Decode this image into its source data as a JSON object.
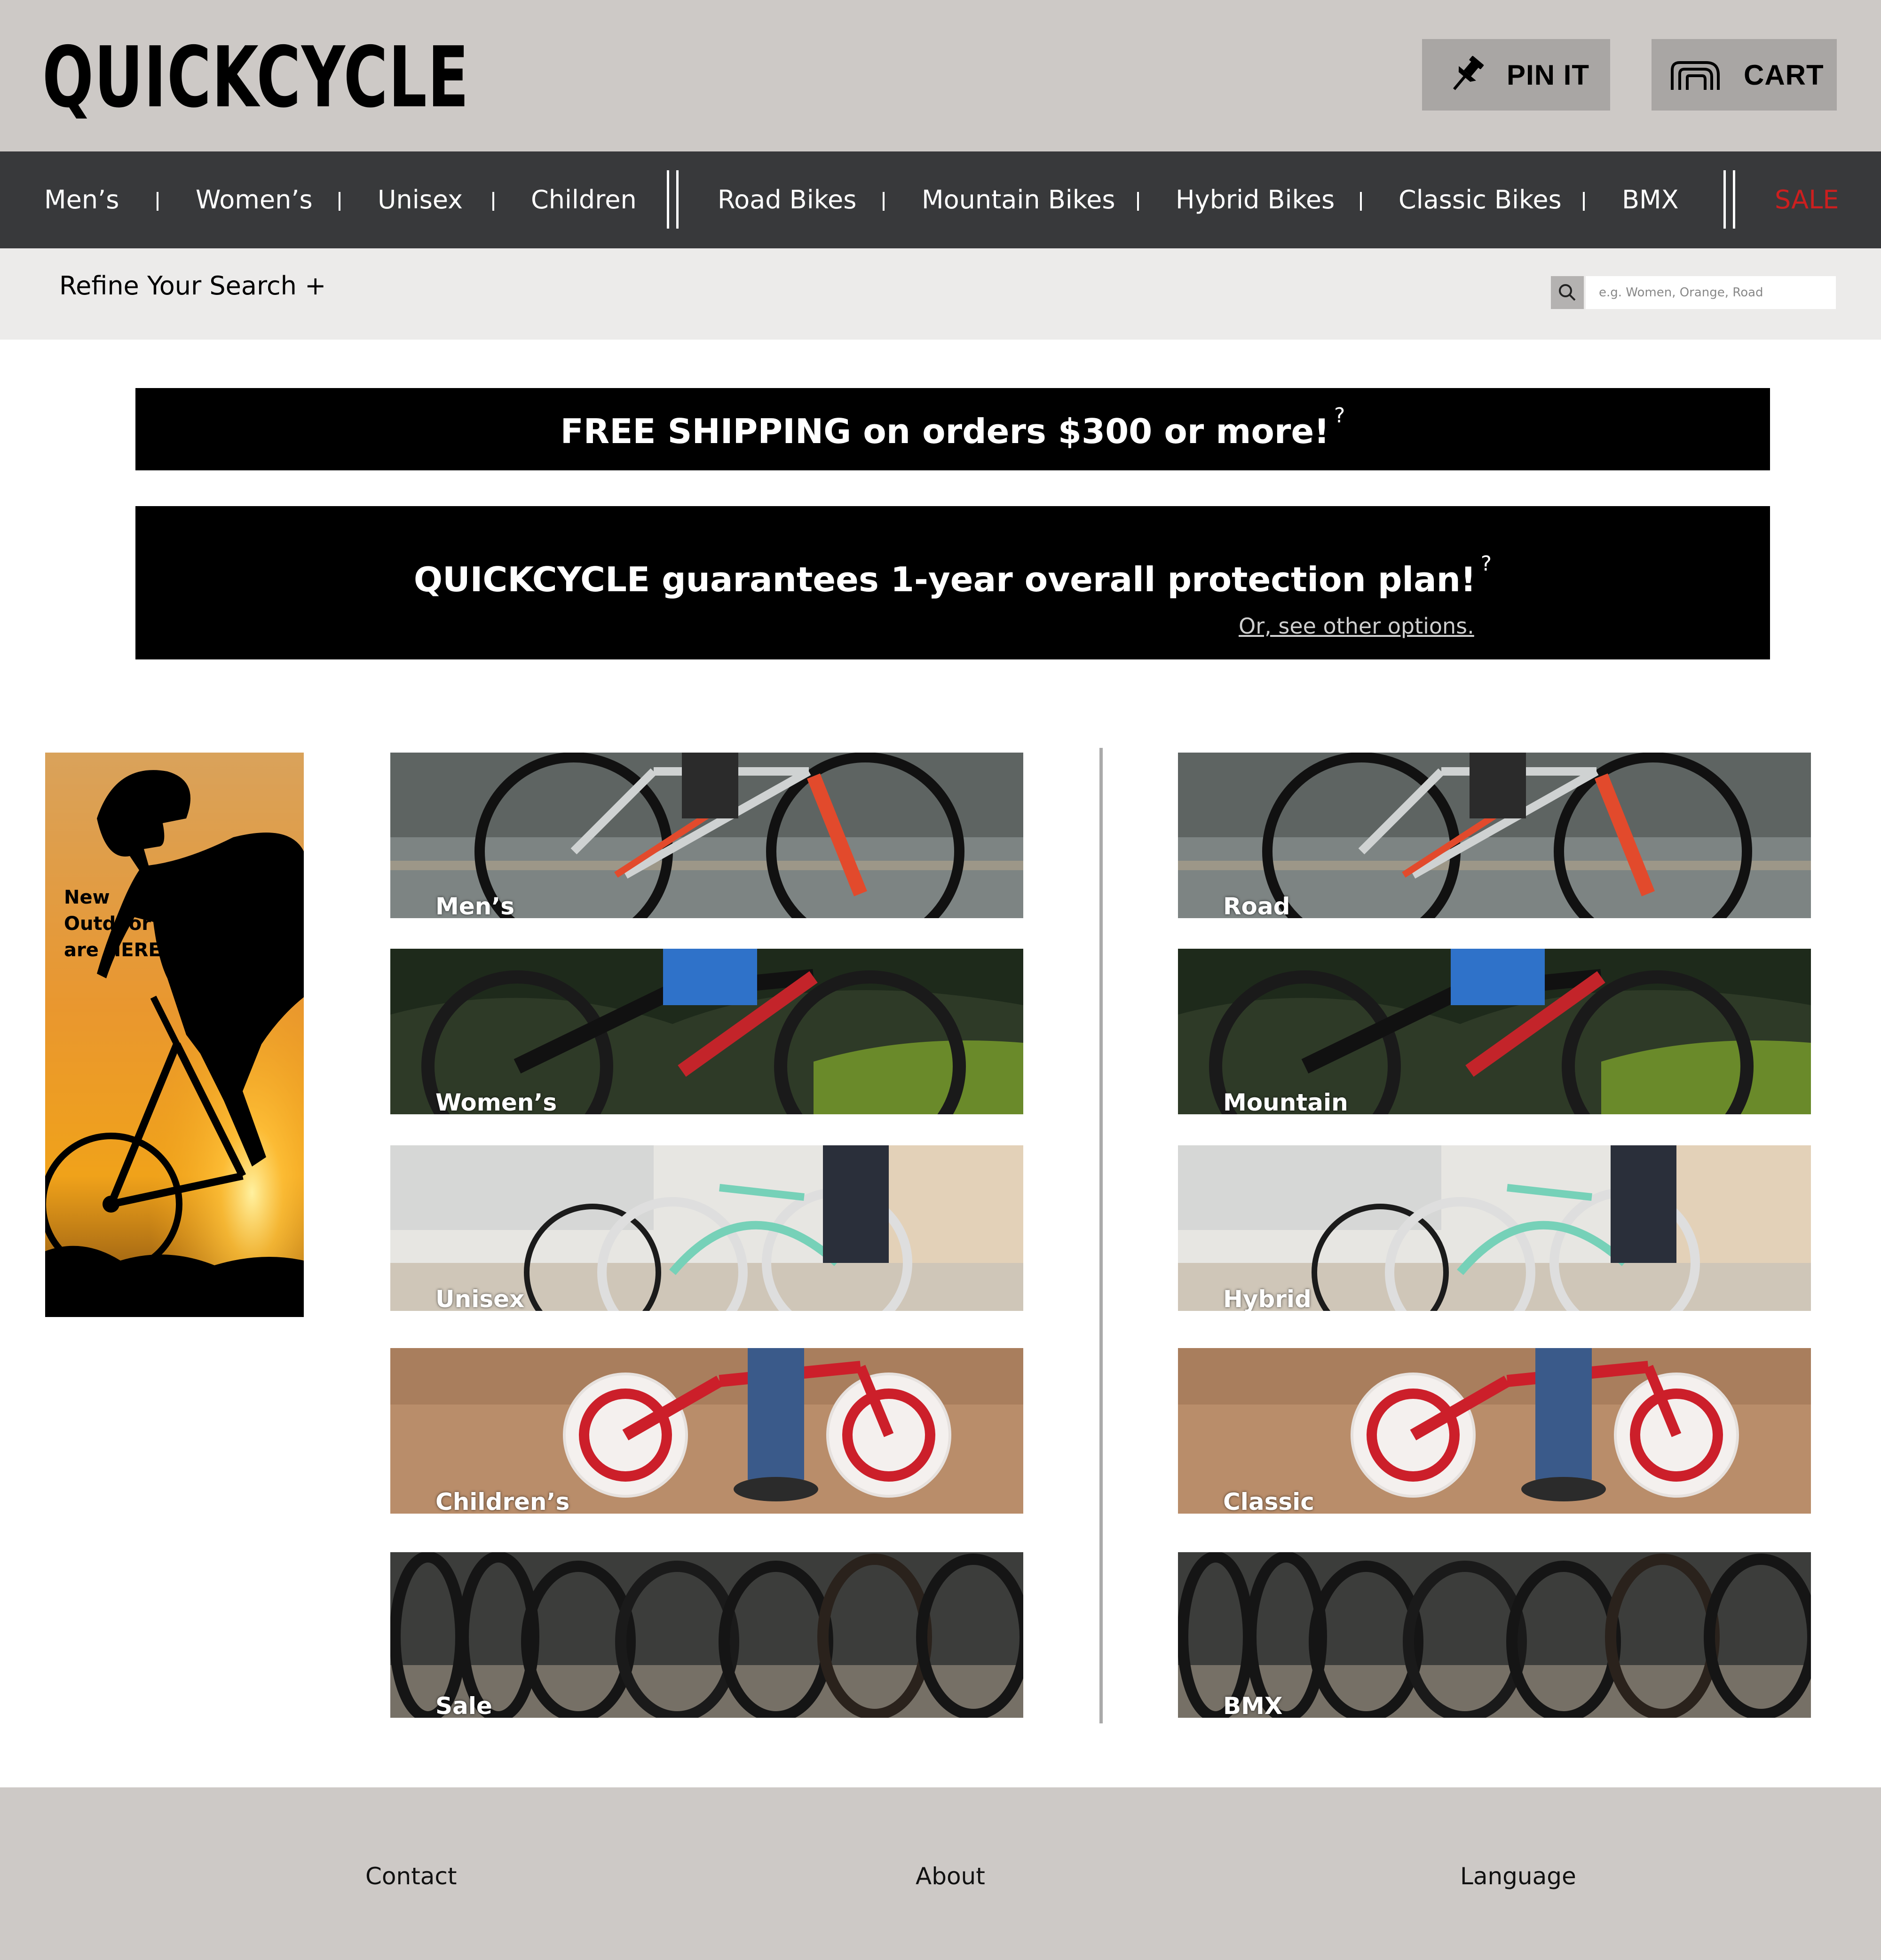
{
  "header": {
    "logo": "QUICKCYCLE",
    "pin_label": "PIN IT",
    "cart_label": "CART"
  },
  "nav": {
    "items": [
      "Men’s",
      "Women’s",
      "Unisex",
      "Children",
      "Road Bikes",
      "Mountain Bikes",
      "Hybrid Bikes",
      "Classic Bikes",
      "BMX"
    ],
    "sale": "SALE",
    "sale_color": "#cc1f1f"
  },
  "refine": {
    "label": "Refine Your Search +",
    "search_placeholder": "e.g. Women, Orange, Road"
  },
  "banners": {
    "shipping": "FREE SHIPPING on orders $300 or more!",
    "shipping_help": "?",
    "protection": "QUICKCYCLE guarantees 1-year overall protection plan!",
    "protection_help": "?",
    "protection_link": "Or, see other options."
  },
  "ad": {
    "line1": "New",
    "line2": "Outdoor Bikes",
    "line3": "are HERE!"
  },
  "tiles": {
    "left": [
      "Men’s",
      "Women’s",
      "Unisex",
      "Children’s",
      "Sale"
    ],
    "right": [
      "Road",
      "Mountain",
      "Hybrid",
      "Classic",
      "BMX"
    ]
  },
  "footer": {
    "contact": "Contact",
    "about": "About",
    "language": "Language"
  },
  "colors": {
    "header_bg": "#cdc9c6",
    "nav_bg": "#38393b",
    "banner_bg": "#000000"
  }
}
